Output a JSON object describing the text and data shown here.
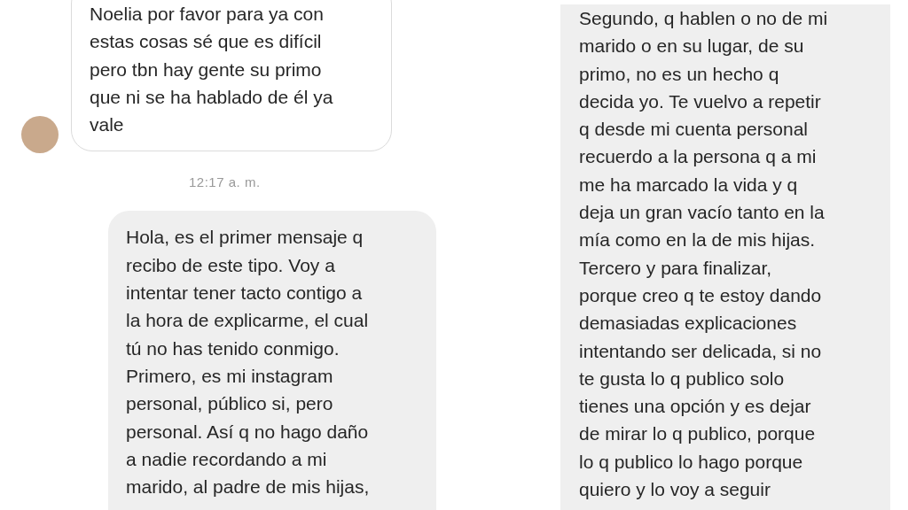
{
  "left_chat": {
    "messages": [
      {
        "kind": "incoming",
        "text": "Noelia por favor para ya con\nestas cosas sé que es difícil\npero tbn hay gente su primo\nque ni se ha hablado de él ya\nvale"
      },
      {
        "kind": "timestamp",
        "text": "12:17 a. m."
      },
      {
        "kind": "outgoing",
        "text": "Hola, es el primer mensaje q\nrecibo de este tipo. Voy a\nintentar tener tacto contigo a\nla hora de explicarme, el cual\ntú no has tenido conmigo.\nPrimero, es mi instagram\npersonal, público si, pero\npersonal. Así q no hago daño\na nadie recordando a mi\nmarido, al padre de mis hijas,"
      }
    ]
  },
  "right_chat": {
    "messages": [
      {
        "kind": "outgoing",
        "text": "Segundo, q hablen o no de mi\nmarido o en su lugar, de su\nprimo, no es un hecho q\ndecida yo. Te vuelvo a repetir\nq desde mi cuenta personal\nrecuerdo a la persona q a mi\nme ha marcado la vida y q\ndeja un gran vacío tanto en la\nmía como en la de mis hijas.\nTercero y para finalizar,\nporque creo q te estoy dando\ndemasiadas explicaciones\nintentando ser delicada, si no\nte gusta lo q publico solo\ntienes una opción y es dejar\nde mirar lo q publico, porque\nlo q publico lo hago porque\nquiero y lo voy a seguir"
      }
    ]
  }
}
